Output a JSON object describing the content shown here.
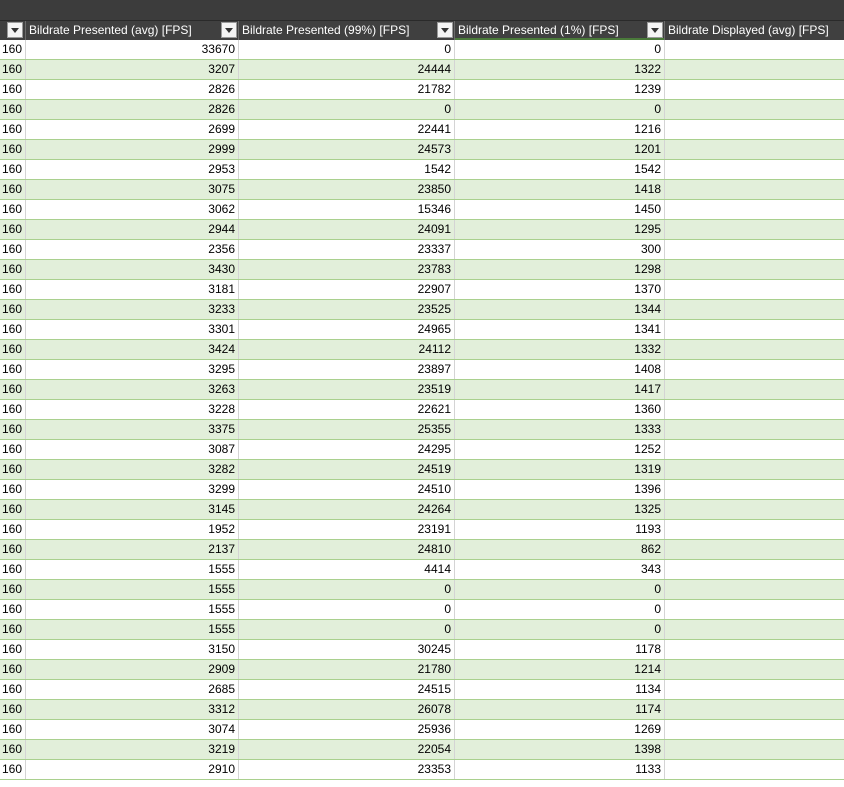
{
  "headers": [
    "",
    "Bildrate Presented (avg) [FPS]",
    "Bildrate Presented (99%) [FPS]",
    "Bildrate Presented (1%) [FPS]",
    "Bildrate Displayed (avg) [FPS]"
  ],
  "rows": [
    [
      "160",
      "33670",
      "0",
      "0",
      ""
    ],
    [
      "160",
      "3207",
      "24444",
      "1322",
      ""
    ],
    [
      "160",
      "2826",
      "21782",
      "1239",
      ""
    ],
    [
      "160",
      "2826",
      "0",
      "0",
      ""
    ],
    [
      "160",
      "2699",
      "22441",
      "1216",
      ""
    ],
    [
      "160",
      "2999",
      "24573",
      "1201",
      ""
    ],
    [
      "160",
      "2953",
      "1542",
      "1542",
      ""
    ],
    [
      "160",
      "3075",
      "23850",
      "1418",
      ""
    ],
    [
      "160",
      "3062",
      "15346",
      "1450",
      ""
    ],
    [
      "160",
      "2944",
      "24091",
      "1295",
      ""
    ],
    [
      "160",
      "2356",
      "23337",
      "300",
      ""
    ],
    [
      "160",
      "3430",
      "23783",
      "1298",
      ""
    ],
    [
      "160",
      "3181",
      "22907",
      "1370",
      ""
    ],
    [
      "160",
      "3233",
      "23525",
      "1344",
      ""
    ],
    [
      "160",
      "3301",
      "24965",
      "1341",
      ""
    ],
    [
      "160",
      "3424",
      "24112",
      "1332",
      ""
    ],
    [
      "160",
      "3295",
      "23897",
      "1408",
      ""
    ],
    [
      "160",
      "3263",
      "23519",
      "1417",
      ""
    ],
    [
      "160",
      "3228",
      "22621",
      "1360",
      ""
    ],
    [
      "160",
      "3375",
      "25355",
      "1333",
      ""
    ],
    [
      "160",
      "3087",
      "24295",
      "1252",
      ""
    ],
    [
      "160",
      "3282",
      "24519",
      "1319",
      ""
    ],
    [
      "160",
      "3299",
      "24510",
      "1396",
      ""
    ],
    [
      "160",
      "3145",
      "24264",
      "1325",
      ""
    ],
    [
      "160",
      "1952",
      "23191",
      "1193",
      ""
    ],
    [
      "160",
      "2137",
      "24810",
      "862",
      ""
    ],
    [
      "160",
      "1555",
      "4414",
      "343",
      ""
    ],
    [
      "160",
      "1555",
      "0",
      "0",
      ""
    ],
    [
      "160",
      "1555",
      "0",
      "0",
      ""
    ],
    [
      "160",
      "1555",
      "0",
      "0",
      ""
    ],
    [
      "160",
      "3150",
      "30245",
      "1178",
      ""
    ],
    [
      "160",
      "2909",
      "21780",
      "1214",
      ""
    ],
    [
      "160",
      "2685",
      "24515",
      "1134",
      ""
    ],
    [
      "160",
      "3312",
      "26078",
      "1174",
      ""
    ],
    [
      "160",
      "3074",
      "25936",
      "1269",
      ""
    ],
    [
      "160",
      "3219",
      "22054",
      "1398",
      ""
    ],
    [
      "160",
      "2910",
      "23353",
      "1133",
      ""
    ]
  ],
  "colors": {
    "header_bg": "#404040",
    "band": "#e2efda",
    "band_border": "#a9d08e"
  },
  "icons": {
    "filter": "dropdown-arrow-icon"
  }
}
